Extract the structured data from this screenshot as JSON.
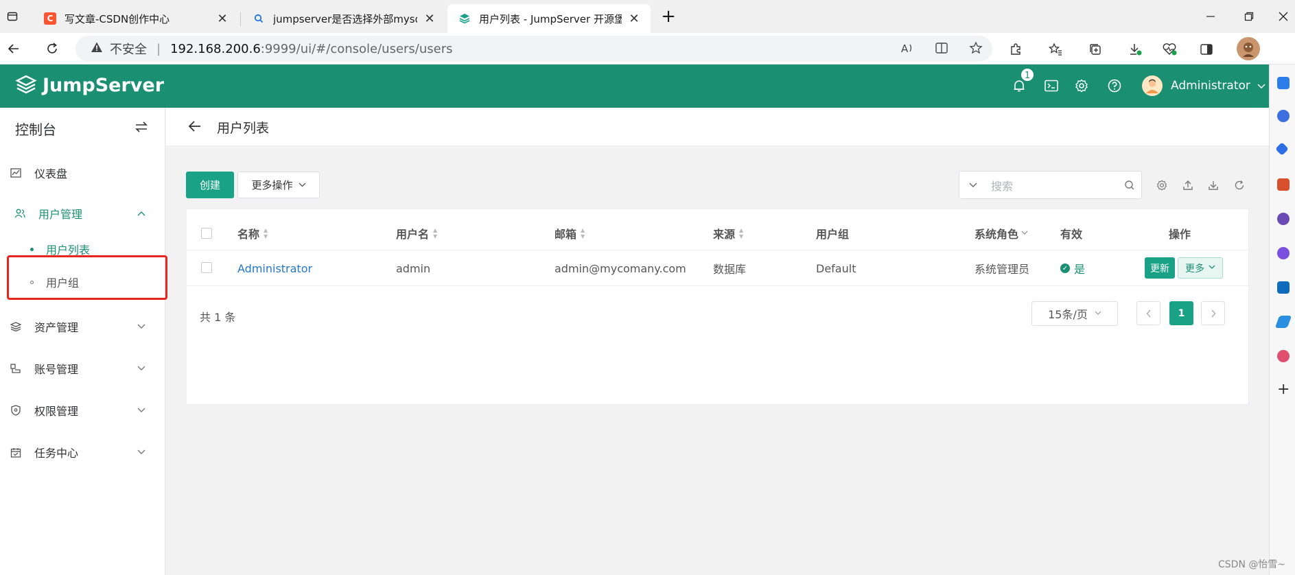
{
  "browser": {
    "tabs": [
      {
        "title": "写文章-CSDN创作中心",
        "icon": "csdn-icon"
      },
      {
        "title": "jumpserver是否选择外部mysql -",
        "icon": "search-icon"
      },
      {
        "title": "用户列表 - JumpServer 开源堡垒",
        "icon": "jumpserver-icon",
        "active": true
      }
    ],
    "insecure_label": "不安全",
    "url_host": "192.168.200.6",
    "url_path": ":9999/ui/#/console/users/users"
  },
  "app": {
    "brand": "JumpServer",
    "notification_count": "1",
    "user_name": "Administrator",
    "accent_color": "#1a8f72"
  },
  "sidebar": {
    "header": "控制台",
    "items": [
      {
        "label": "仪表盘",
        "icon": "chart-icon"
      },
      {
        "label": "用户管理",
        "icon": "users-icon",
        "expanded": true
      },
      {
        "label": "资产管理",
        "icon": "layers-icon"
      },
      {
        "label": "账号管理",
        "icon": "account-icon"
      },
      {
        "label": "权限管理",
        "icon": "shield-icon"
      },
      {
        "label": "任务中心",
        "icon": "calendar-icon"
      }
    ],
    "sub_items": [
      {
        "label": "用户列表",
        "active": true
      },
      {
        "label": "用户组"
      }
    ]
  },
  "page": {
    "title": "用户列表",
    "create_label": "创建",
    "more_actions_label": "更多操作",
    "search_placeholder": "搜索"
  },
  "table": {
    "headers": {
      "name": "名称",
      "username": "用户名",
      "email": "邮箱",
      "source": "来源",
      "groups": "用户组",
      "role": "系统角色",
      "active": "有效",
      "actions": "操作"
    },
    "rows": [
      {
        "name": "Administrator",
        "username": "admin",
        "email": "admin@mycomany.com",
        "source": "数据库",
        "groups": "Default",
        "role": "系统管理员",
        "active": "是",
        "update_label": "更新",
        "more_label": "更多"
      }
    ],
    "total": "共 1 条",
    "page_size": "15条/页",
    "current_page": "1"
  },
  "watermark": "CSDN @怡雪~"
}
